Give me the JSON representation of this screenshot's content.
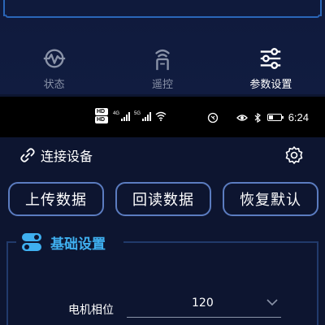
{
  "tabs": [
    {
      "label": "状态",
      "icon": "status-pulse-icon",
      "active": false
    },
    {
      "label": "遥控",
      "icon": "remote-signal-icon",
      "active": false
    },
    {
      "label": "参数设置",
      "icon": "sliders-icon",
      "active": true
    }
  ],
  "statusbar": {
    "hd_badges": [
      "HD",
      "HD"
    ],
    "sim1_label": "4G",
    "sim2_label": "5G",
    "time": "6:24"
  },
  "device": {
    "connect_label": "连接设备",
    "link_icon": "link-icon",
    "settings_icon": "gear-icon"
  },
  "actions": {
    "upload_label": "上传数据",
    "readback_label": "回读数据",
    "restore_label": "恢复默认"
  },
  "basic_settings": {
    "title": "基础设置",
    "icon": "toggle-settings-icon",
    "fields": [
      {
        "label": "电机相位",
        "value": "120"
      }
    ]
  },
  "colors": {
    "background": "#0d1530",
    "accent": "#3fb0f0",
    "button_border": "#5b7cc0",
    "inactive_tab": "#8a93a8"
  }
}
